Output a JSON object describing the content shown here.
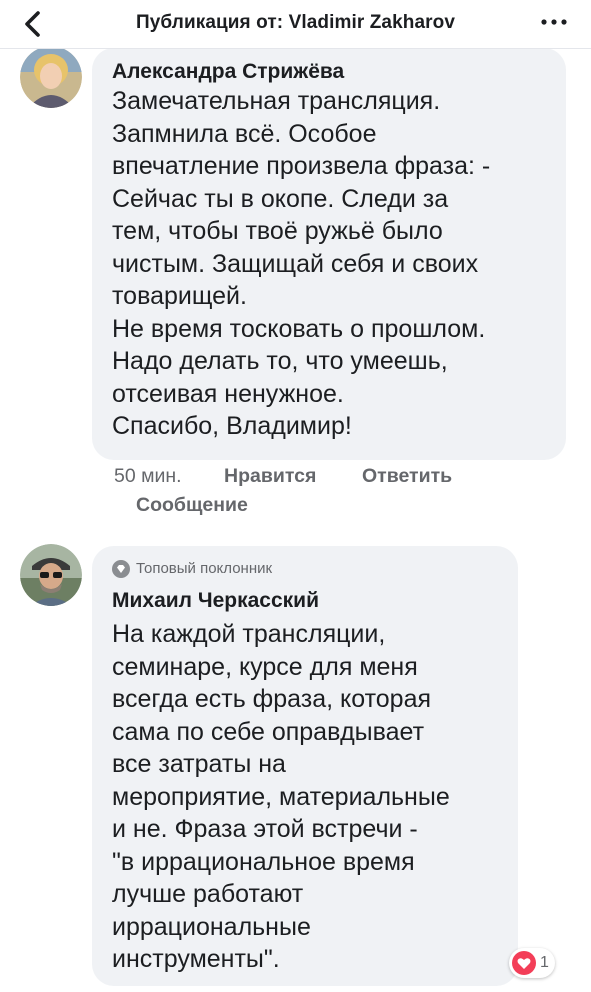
{
  "header": {
    "title": "Публикация от: Vladimir Zakharov"
  },
  "comments": [
    {
      "author": "Александра Стрижёва",
      "text": "Замечательная трансляция.\nЗапмнила всё. Особое\nвпечатление произвела фраза: -\nСейчас ты в окопе. Следи за\nтем, чтобы твоё ружьё было\nчистым. Защищай себя и своих\nтоварищей.\nНе время тосковать о прошлом.\nНадо делать то, что умеешь,\nотсеивая ненужное.\nСпасибо, Владимир!",
      "time": "50 мин.",
      "like_label": "Нравится",
      "reply_label": "Ответить",
      "message_label": "Сообщение"
    },
    {
      "badge": "Топовый поклонник",
      "author": "Михаил Черкасский",
      "text": "На каждой трансляции,\nсеминаре, курсе для меня\nвсегда есть фраза, которая\nсама по себе оправдывает\nвсе затраты на\nмероприятие, материальные\nи не. Фраза этой встречи -\n\"в иррациональное время\nлучше работают\nиррациональные\nинструменты\".",
      "reaction_count": "1",
      "reaction_icon": "love-reaction-icon"
    }
  ],
  "colors": {
    "bubble": "#f0f2f5",
    "meta": "#65676b",
    "love": "#f33e58"
  }
}
